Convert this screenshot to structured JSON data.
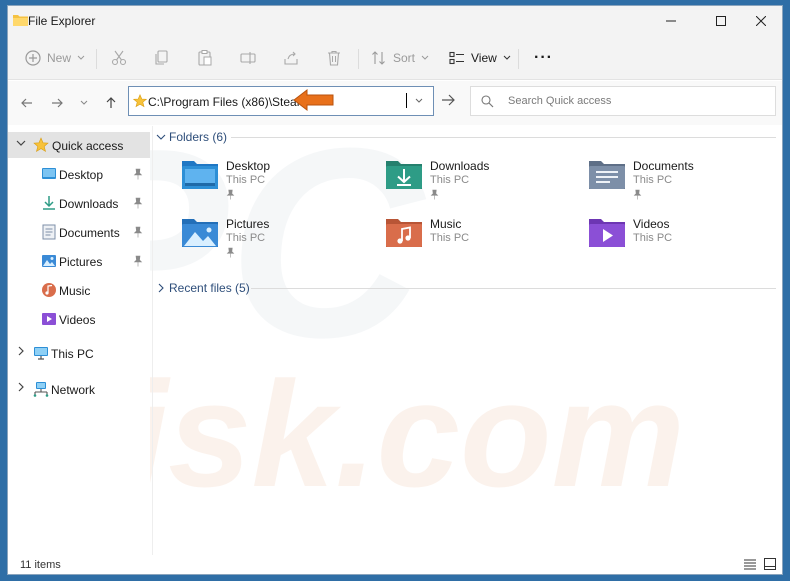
{
  "window": {
    "title": "File Explorer"
  },
  "commandbar": {
    "new_label": "New",
    "sort_label": "Sort",
    "view_label": "View",
    "more_label": "···"
  },
  "address": {
    "path": "C:\\Program Files (x86)\\Steam",
    "search_placeholder": "Search Quick access"
  },
  "navpane": {
    "quick_access": "Quick access",
    "items": [
      {
        "label": "Desktop",
        "icon": "desktop-icon",
        "pinned": true
      },
      {
        "label": "Downloads",
        "icon": "downloads-icon",
        "pinned": true
      },
      {
        "label": "Documents",
        "icon": "documents-icon",
        "pinned": true
      },
      {
        "label": "Pictures",
        "icon": "pictures-icon",
        "pinned": true
      },
      {
        "label": "Music",
        "icon": "music-icon",
        "pinned": false
      },
      {
        "label": "Videos",
        "icon": "videos-icon",
        "pinned": false
      }
    ],
    "this_pc": "This PC",
    "network": "Network"
  },
  "content": {
    "folders_header": "Folders (6)",
    "recent_header": "Recent files (5)",
    "folders": [
      {
        "name": "Desktop",
        "location": "This PC",
        "pinned": true,
        "icon": "desktop-folder-icon"
      },
      {
        "name": "Downloads",
        "location": "This PC",
        "pinned": true,
        "icon": "downloads-folder-icon"
      },
      {
        "name": "Documents",
        "location": "This PC",
        "pinned": true,
        "icon": "documents-folder-icon"
      },
      {
        "name": "Pictures",
        "location": "This PC",
        "pinned": true,
        "icon": "pictures-folder-icon"
      },
      {
        "name": "Music",
        "location": "This PC",
        "pinned": false,
        "icon": "music-folder-icon"
      },
      {
        "name": "Videos",
        "location": "This PC",
        "pinned": false,
        "icon": "videos-folder-icon"
      }
    ]
  },
  "statusbar": {
    "item_count": "11 items"
  },
  "colors": {
    "accent": "#0067c0",
    "annotation_arrow": "#e8701a",
    "desktop_folder": "#2d8fd6",
    "downloads_folder": "#2e9c86",
    "documents_folder": "#7d8fa8",
    "pictures_folder": "#3a8ad6",
    "music_folder": "#d96d4b",
    "videos_folder": "#8b4fd6"
  }
}
